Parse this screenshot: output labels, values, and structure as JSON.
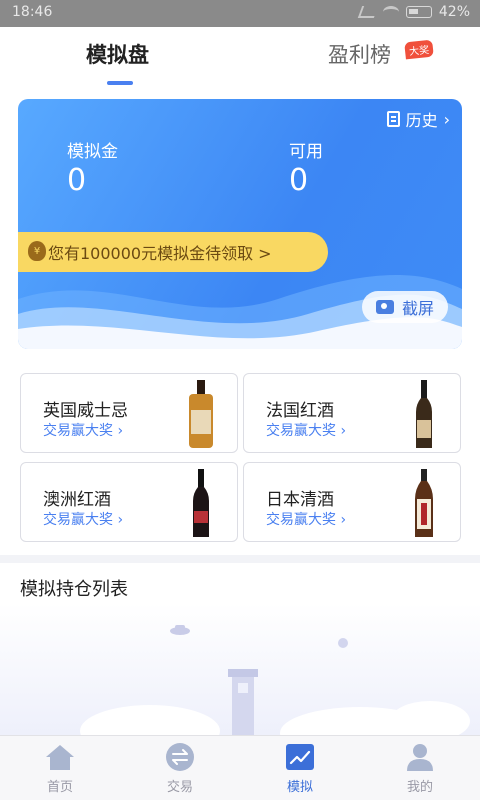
{
  "status_bar": {
    "time": "18:46",
    "battery": "42%"
  },
  "top_tabs": {
    "active": "模拟盘",
    "other": "盈利榜",
    "badge": "大奖"
  },
  "hero": {
    "history_label": "历史",
    "fund_label": "模拟金",
    "fund_value": "0",
    "available_label": "可用",
    "available_value": "0",
    "claim_text": "您有100000元模拟金待领取 >",
    "screenshot_label": "截屏"
  },
  "products": [
    {
      "name": "英国威士忌",
      "link": "交易赢大奖 ›",
      "bottle_color": "#c9892c",
      "label_color": "#e9d9b8"
    },
    {
      "name": "法国红酒",
      "link": "交易赢大奖 ›",
      "bottle_color": "#3a2a1a",
      "label_color": "#d9c29a"
    },
    {
      "name": "澳洲红酒",
      "link": "交易赢大奖 ›",
      "bottle_color": "#1c1416",
      "label_color": "#b83238"
    },
    {
      "name": "日本清酒",
      "link": "交易赢大奖 ›",
      "bottle_color": "#5a3018",
      "label_color": "#f4ead8"
    }
  ],
  "holdings": {
    "title": "模拟持仓列表"
  },
  "bottom_nav": [
    {
      "label": "首页",
      "icon": "home-icon"
    },
    {
      "label": "交易",
      "icon": "trade-icon"
    },
    {
      "label": "模拟",
      "icon": "simulate-icon"
    },
    {
      "label": "我的",
      "icon": "profile-icon"
    }
  ],
  "colors": {
    "accent": "#4a80f0",
    "hero_blue": "#3c86f4",
    "claim_yellow": "#f9d862",
    "prize_red": "#f0503c"
  }
}
